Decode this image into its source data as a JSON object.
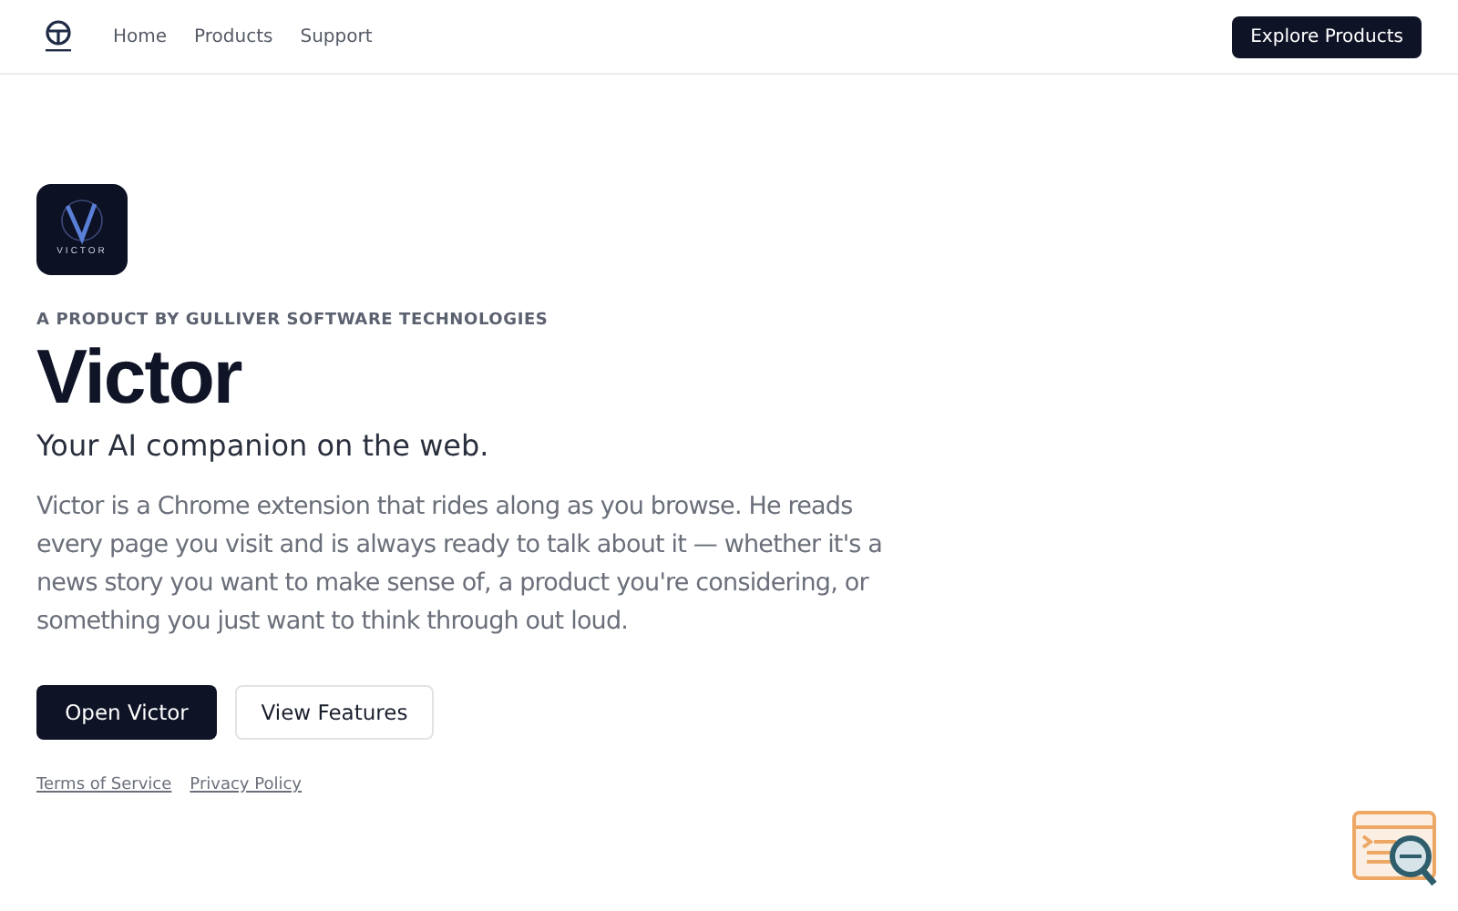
{
  "nav": {
    "links": [
      "Home",
      "Products",
      "Support"
    ],
    "cta": "Explore Products"
  },
  "hero": {
    "app_icon_caption": "VICTOR",
    "eyebrow": "A PRODUCT BY GULLIVER SOFTWARE TECHNOLOGIES",
    "title": "Victor",
    "subtitle": "Your AI companion on the web.",
    "description": "Victor is a Chrome extension that rides along as you browse. He reads every page you visit and is always ready to talk about it — whether it's a news story you want to make sense of, a product you're considering, or something you just want to think through out loud.",
    "buttons": [
      {
        "label": "Open Victor",
        "kind": "primary"
      },
      {
        "label": "View Features",
        "kind": "secondary"
      }
    ],
    "links": [
      "Terms of Service",
      "Privacy Policy"
    ]
  }
}
